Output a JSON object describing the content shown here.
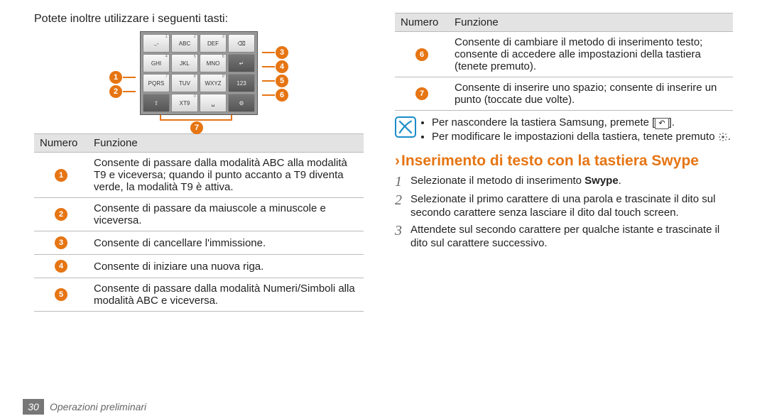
{
  "left": {
    "intro": "Potete inoltre utilizzare i seguenti tasti:",
    "keypad": {
      "rows": [
        [
          {
            "label": ".,-",
            "sup": "1"
          },
          {
            "label": "ABC",
            "sup": "2"
          },
          {
            "label": "DEF",
            "sup": "3"
          },
          {
            "label": "⌫",
            "dark": false
          }
        ],
        [
          {
            "label": "GHI",
            "sup": "4"
          },
          {
            "label": "JKL",
            "sup": "5"
          },
          {
            "label": "MNO",
            "sup": "6"
          },
          {
            "label": "↵",
            "dark": true
          }
        ],
        [
          {
            "label": "PQRS",
            "sup": "7"
          },
          {
            "label": "TUV",
            "sup": "8"
          },
          {
            "label": "WXYZ",
            "sup": "9"
          },
          {
            "label": "123",
            "dark": true
          }
        ],
        [
          {
            "label": "⇧",
            "dark": true
          },
          {
            "label": "XT9",
            "sup": "0"
          },
          {
            "label": "␣",
            "dark": false
          },
          {
            "label": "⚙",
            "dark": true
          }
        ]
      ],
      "left_callouts": [
        "1",
        "2"
      ],
      "right_callouts": [
        "3",
        "4",
        "5",
        "6"
      ],
      "bottom_callout": "7"
    },
    "table_headers": {
      "num": "Numero",
      "func": "Funzione"
    },
    "rows": [
      {
        "n": "1",
        "text": "Consente di passare dalla modalità ABC alla modalità T9 e viceversa; quando il punto accanto a T9 diventa verde, la modalità T9 è attiva."
      },
      {
        "n": "2",
        "text": "Consente di passare da maiuscole a minuscole e viceversa."
      },
      {
        "n": "3",
        "text": "Consente di cancellare l'immissione."
      },
      {
        "n": "4",
        "text": "Consente di iniziare una nuova riga."
      },
      {
        "n": "5",
        "text": "Consente di passare dalla modalità Numeri/Simboli alla modalità ABC e viceversa."
      }
    ]
  },
  "right": {
    "table_headers": {
      "num": "Numero",
      "func": "Funzione"
    },
    "rows": [
      {
        "n": "6",
        "text": "Consente di cambiare il metodo di inserimento testo; consente di accedere alle impostazioni della tastiera (tenete premuto)."
      },
      {
        "n": "7",
        "text": "Consente di inserire uno spazio; consente di inserire un punto (toccate due volte)."
      }
    ],
    "notes": [
      "Per nascondere la tastiera Samsung, premete [↶].",
      "Per modificare le impostazioni della tastiera, tenete premuto ⚙."
    ],
    "section_title": "Inserimento di testo con la tastiera Swype",
    "steps": [
      {
        "n": "1",
        "html": "Selezionate il metodo di inserimento <b>Swype</b>."
      },
      {
        "n": "2",
        "html": "Selezionate il primo carattere di una parola e trascinate il dito sul secondo carattere senza lasciare il dito dal touch screen."
      },
      {
        "n": "3",
        "html": "Attendete sul secondo carattere per qualche istante e trascinate il dito sul carattere successivo."
      }
    ]
  },
  "footer": {
    "page_number": "30",
    "section": "Operazioni preliminari"
  }
}
